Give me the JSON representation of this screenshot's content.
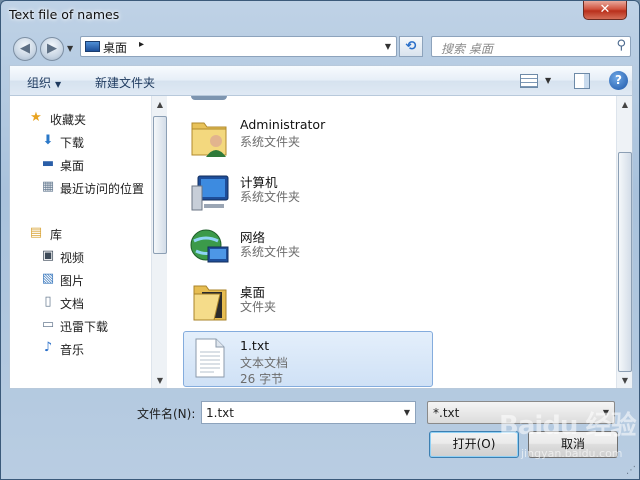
{
  "window": {
    "title": "Text file of names",
    "close_label": "✕"
  },
  "address": {
    "location": "桌面",
    "separator": "▸",
    "refresh_glyph": "⟲",
    "search_placeholder": "搜索 桌面"
  },
  "toolbar": {
    "organize_label": "组织",
    "new_folder_label": "新建文件夹"
  },
  "sidebar": {
    "items": [
      {
        "label": "收藏夹",
        "icon": "star-icon",
        "glyph": "★",
        "color": "#e8a320"
      },
      {
        "label": "下载",
        "icon": "download-folder-icon",
        "glyph": "⬇",
        "color": "#2a78c8"
      },
      {
        "label": "桌面",
        "icon": "desktop-icon",
        "glyph": "▬",
        "color": "#2a5ea8"
      },
      {
        "label": "最近访问的位置",
        "icon": "recent-places-icon",
        "glyph": "▦",
        "color": "#6b7f95"
      },
      {
        "label": "库",
        "icon": "libraries-icon",
        "glyph": "▤",
        "color": "#d9a53a"
      },
      {
        "label": "视频",
        "icon": "video-icon",
        "glyph": "▣",
        "color": "#3d4a58"
      },
      {
        "label": "图片",
        "icon": "pictures-icon",
        "glyph": "▧",
        "color": "#3f7cbf"
      },
      {
        "label": "文档",
        "icon": "documents-icon",
        "glyph": "▯",
        "color": "#6d7f94"
      },
      {
        "label": "迅雷下载",
        "icon": "thunder-download-icon",
        "glyph": "▭",
        "color": "#6d7f94"
      },
      {
        "label": "音乐",
        "icon": "music-icon",
        "glyph": "♪",
        "color": "#2a6fc9"
      }
    ]
  },
  "files": [
    {
      "name": "Administrator",
      "type": "系统文件夹",
      "size": "",
      "icon": "user-folder-icon",
      "selected": false
    },
    {
      "name": "计算机",
      "type": "系统文件夹",
      "size": "",
      "icon": "computer-icon",
      "selected": false
    },
    {
      "name": "网络",
      "type": "系统文件夹",
      "size": "",
      "icon": "network-icon",
      "selected": false
    },
    {
      "name": "桌面",
      "type": "文件夹",
      "size": "",
      "icon": "folder-icon",
      "selected": false
    },
    {
      "name": "1.txt",
      "type": "文本文档",
      "size": "26 字节",
      "icon": "text-file-icon",
      "selected": true
    }
  ],
  "footer": {
    "filename_label": "文件名(N):",
    "filename_value": "1.txt",
    "filetype_value": "*.txt",
    "open_label": "打开(O)",
    "cancel_label": "取消"
  },
  "watermark": {
    "text": "Baidu 经验",
    "sub": "jingyan.baidu.com"
  }
}
